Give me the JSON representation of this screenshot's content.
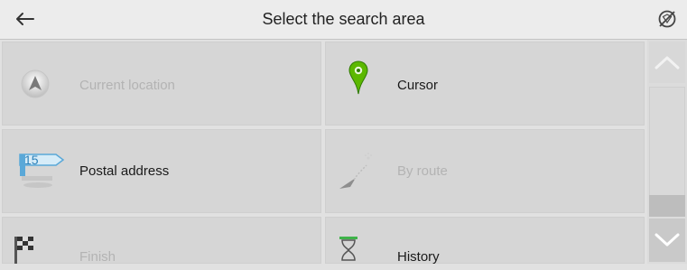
{
  "header": {
    "title": "Select the search area",
    "back_icon": "back-arrow-icon",
    "gps_icon": "no-gps-icon"
  },
  "options": [
    {
      "label": "Current location",
      "icon": "location-arrow-icon",
      "enabled": false
    },
    {
      "label": "Cursor",
      "icon": "map-pin-icon",
      "enabled": true
    },
    {
      "label": "Postal address",
      "icon": "address-sign-icon",
      "badge": "15",
      "enabled": true
    },
    {
      "label": "By route",
      "icon": "route-icon",
      "enabled": false
    },
    {
      "label": "Finish",
      "icon": "checkered-flag-icon",
      "enabled": false
    },
    {
      "label": "History",
      "icon": "hourglass-icon",
      "enabled": true
    }
  ],
  "scrollbar": {
    "up_icon": "chevron-up-icon",
    "down_icon": "chevron-down-icon"
  },
  "colors": {
    "pin_green": "#5cb800",
    "history_green": "#3fb34a",
    "sign_blue": "#5aa8d8"
  }
}
